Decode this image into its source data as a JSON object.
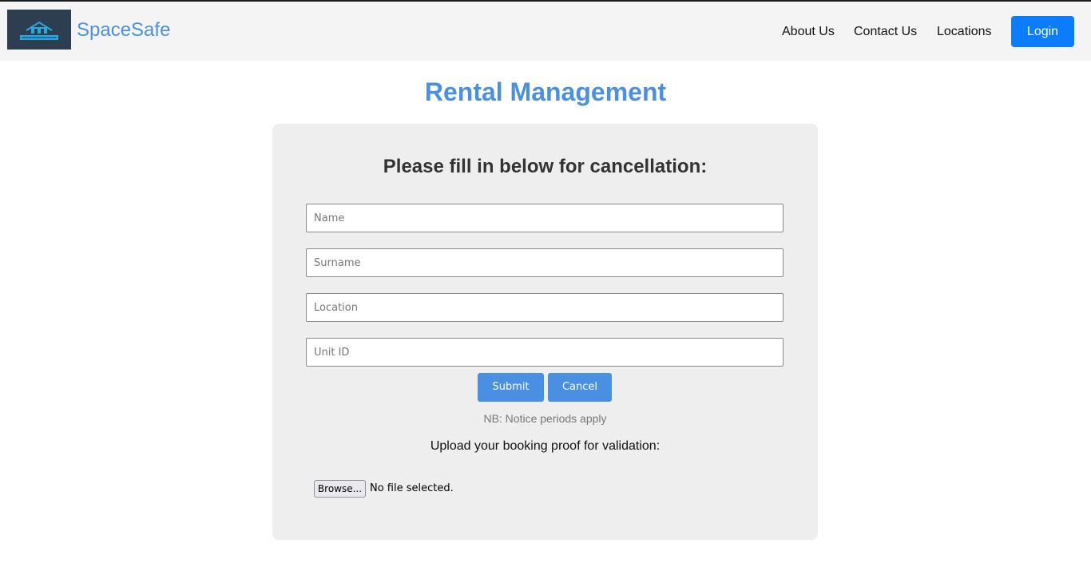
{
  "header": {
    "brand": "SpaceSafe",
    "logo_icon": "storage-logo-icon",
    "nav": {
      "about": "About Us",
      "contact": "Contact Us",
      "locations": "Locations"
    },
    "login_label": "Login"
  },
  "page": {
    "title": "Rental Management"
  },
  "form": {
    "heading": "Please fill in below for cancellation:",
    "fields": {
      "name": {
        "placeholder": "Name",
        "value": ""
      },
      "surname": {
        "placeholder": "Surname",
        "value": ""
      },
      "location": {
        "placeholder": "Location",
        "value": ""
      },
      "unit_id": {
        "placeholder": "Unit ID",
        "value": ""
      }
    },
    "submit_label": "Submit",
    "cancel_label": "Cancel",
    "note": "NB: Notice periods apply",
    "upload_label": "Upload your booking proof for validation:",
    "browse_label": "Browse...",
    "file_status": "No file selected."
  },
  "colors": {
    "accent": "#4a90e2",
    "login": "#0b7dfc",
    "card_bg": "#eeeeee",
    "nav_bg": "#f4f4f4"
  }
}
